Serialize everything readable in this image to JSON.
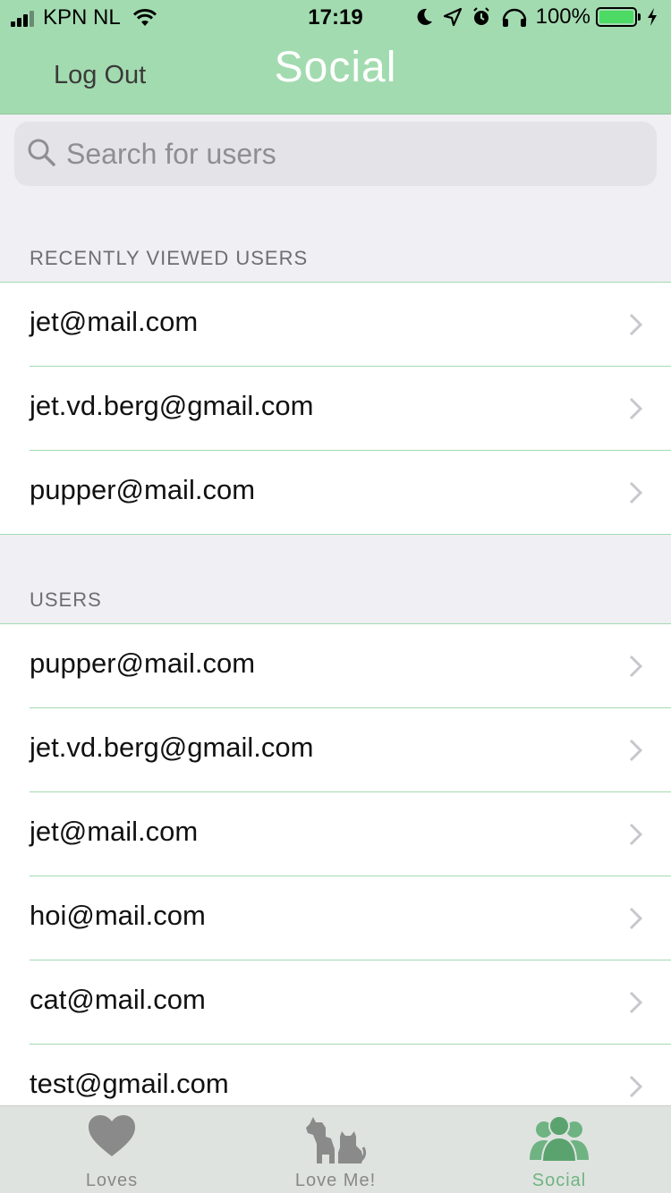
{
  "status_bar": {
    "carrier": "KPN NL",
    "time": "17:19",
    "battery_percent": "100%",
    "icons": [
      "signal-icon",
      "wifi-icon",
      "moon-icon",
      "location-icon",
      "alarm-icon",
      "headphones-icon",
      "battery-icon",
      "charging-icon"
    ]
  },
  "nav": {
    "logout_label": "Log Out",
    "title": "Social"
  },
  "search": {
    "placeholder": "Search for users"
  },
  "recent_section": {
    "header": "RECENTLY VIEWED USERS",
    "items": [
      {
        "label": "jet@mail.com"
      },
      {
        "label": "jet.vd.berg@gmail.com"
      },
      {
        "label": "pupper@mail.com"
      }
    ]
  },
  "users_section": {
    "header": "USERS",
    "items": [
      {
        "label": "pupper@mail.com"
      },
      {
        "label": "jet.vd.berg@gmail.com"
      },
      {
        "label": "jet@mail.com"
      },
      {
        "label": "hoi@mail.com"
      },
      {
        "label": "cat@mail.com"
      },
      {
        "label": "test@gmail.com"
      }
    ]
  },
  "tabs": [
    {
      "label": "Loves",
      "icon": "heart-icon",
      "active": false
    },
    {
      "label": "Love Me!",
      "icon": "dog-cat-icon",
      "active": false
    },
    {
      "label": "Social",
      "icon": "people-icon",
      "active": true
    }
  ],
  "colors": {
    "accent": "#a3dbb0",
    "active_tab": "#6fb383",
    "inactive_tab": "#888888"
  }
}
